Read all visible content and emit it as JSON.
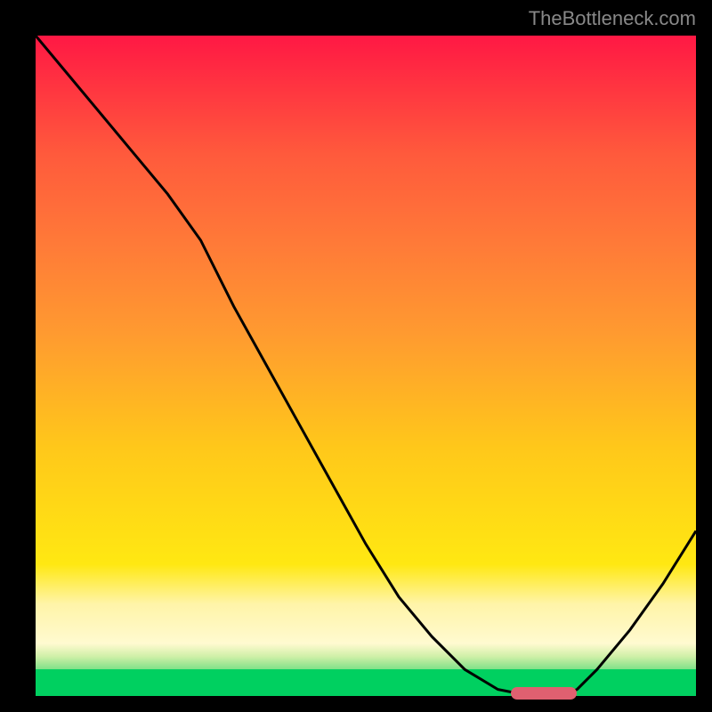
{
  "watermark": "TheBottleneck.com",
  "chart_data": {
    "type": "line",
    "title": "",
    "xlabel": "",
    "ylabel": "",
    "xlim": [
      0,
      100
    ],
    "ylim": [
      0,
      100
    ],
    "zones": [
      {
        "name": "red",
        "y_start": 55,
        "y_end": 100,
        "color_top": "#ff1844",
        "color_bottom": "#ff9a30"
      },
      {
        "name": "orange-yellow",
        "y_start": 20,
        "y_end": 55,
        "color_top": "#ff9a30",
        "color_bottom": "#ffe812"
      },
      {
        "name": "light-yellow",
        "y_start": 8,
        "y_end": 20,
        "color_top": "#ffe812",
        "color_bottom": "#fffad0"
      },
      {
        "name": "transition",
        "y_start": 4,
        "y_end": 8,
        "color_top": "#fffad0",
        "color_bottom": "#80e088"
      },
      {
        "name": "green",
        "y_start": 0,
        "y_end": 4,
        "color_top": "#00d060",
        "color_bottom": "#00d060"
      }
    ],
    "series": [
      {
        "name": "bottleneck-curve",
        "x": [
          0,
          5,
          10,
          15,
          20,
          25,
          30,
          35,
          40,
          45,
          50,
          55,
          60,
          65,
          70,
          75,
          78,
          80,
          82,
          85,
          90,
          95,
          100
        ],
        "y": [
          100,
          94,
          88,
          82,
          76,
          69,
          59,
          50,
          41,
          32,
          23,
          15,
          9,
          4,
          1,
          0,
          0,
          0,
          1,
          4,
          10,
          17,
          25
        ]
      }
    ],
    "optimal_marker": {
      "x_start": 72,
      "x_end": 82,
      "y": 0,
      "color": "#e06070"
    }
  }
}
